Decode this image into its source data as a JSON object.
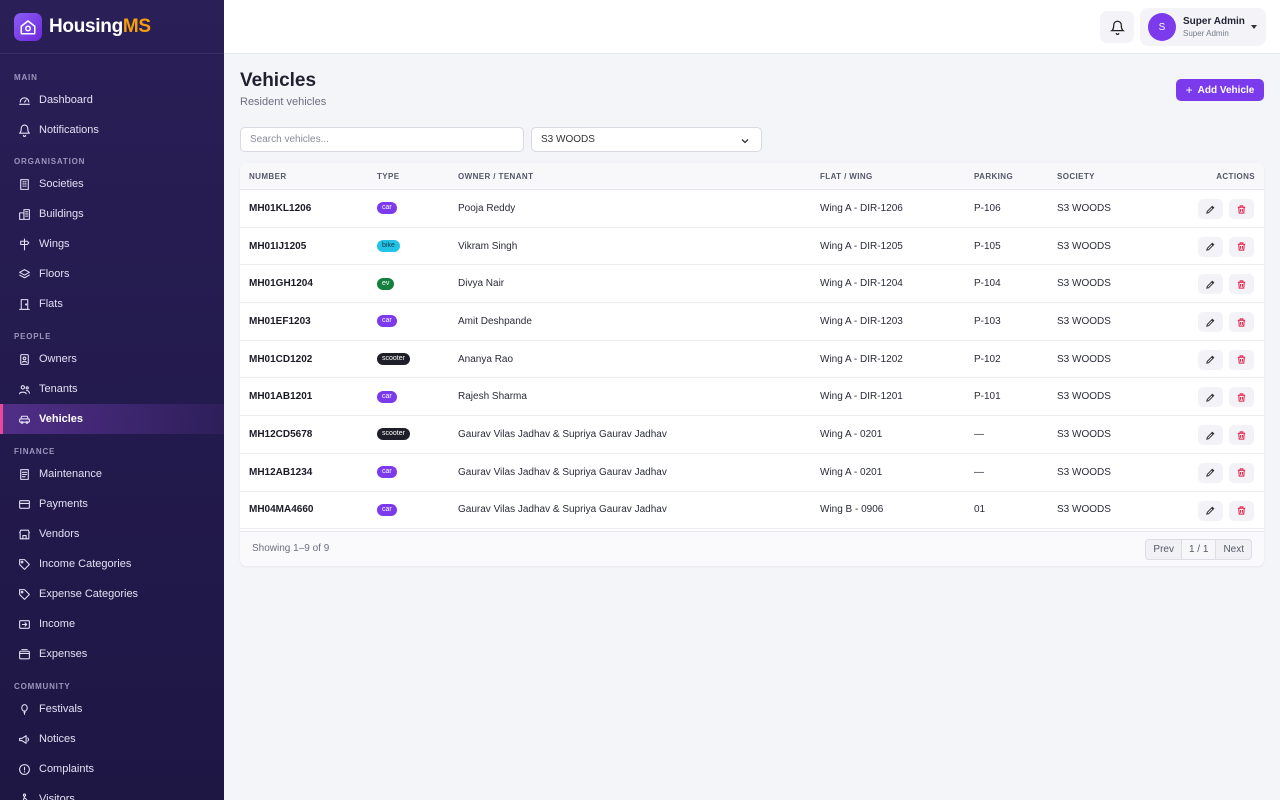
{
  "brand": {
    "name_main": "Housing",
    "name_accent": "MS"
  },
  "sidebar": {
    "sections": [
      {
        "label": "MAIN",
        "items": [
          {
            "label": "Dashboard",
            "icon": "dashboard-gauge-icon"
          },
          {
            "label": "Notifications",
            "icon": "bell-icon"
          }
        ]
      },
      {
        "label": "ORGANISATION",
        "items": [
          {
            "label": "Societies",
            "icon": "building-icon"
          },
          {
            "label": "Buildings",
            "icon": "buildings-icon"
          },
          {
            "label": "Wings",
            "icon": "signpost-icon"
          },
          {
            "label": "Floors",
            "icon": "layers-icon"
          },
          {
            "label": "Flats",
            "icon": "door-icon"
          }
        ]
      },
      {
        "label": "PEOPLE",
        "items": [
          {
            "label": "Owners",
            "icon": "id-badge-icon"
          },
          {
            "label": "Tenants",
            "icon": "users-icon"
          },
          {
            "label": "Vehicles",
            "icon": "car-icon",
            "active": true
          }
        ]
      },
      {
        "label": "FINANCE",
        "items": [
          {
            "label": "Maintenance",
            "icon": "receipt-icon"
          },
          {
            "label": "Payments",
            "icon": "credit-card-icon"
          },
          {
            "label": "Vendors",
            "icon": "store-icon"
          },
          {
            "label": "Income Categories",
            "icon": "tag-icon"
          },
          {
            "label": "Expense Categories",
            "icon": "tag-icon"
          },
          {
            "label": "Income",
            "icon": "transfer-icon"
          },
          {
            "label": "Expenses",
            "icon": "wallet-icon"
          }
        ]
      },
      {
        "label": "COMMUNITY",
        "items": [
          {
            "label": "Festivals",
            "icon": "balloon-icon"
          },
          {
            "label": "Notices",
            "icon": "megaphone-icon"
          },
          {
            "label": "Complaints",
            "icon": "alert-circle-icon"
          },
          {
            "label": "Visitors",
            "icon": "person-walking-icon"
          }
        ]
      }
    ]
  },
  "topbar": {
    "user_initial": "S",
    "user_name": "Super Admin",
    "user_role": "Super Admin"
  },
  "page": {
    "title": "Vehicles",
    "subtitle": "Resident vehicles",
    "add_button": "Add Vehicle"
  },
  "filters": {
    "search_placeholder": "Search vehicles...",
    "society_selected": "S3 WOODS"
  },
  "table": {
    "columns": {
      "number": "NUMBER",
      "type": "TYPE",
      "owner": "OWNER / TENANT",
      "flat": "FLAT / WING",
      "parking": "PARKING",
      "society": "SOCIETY",
      "actions": "ACTIONS"
    },
    "rows": [
      {
        "number": "MH01KL1206",
        "type": "car",
        "owner": "Pooja Reddy",
        "flat": "Wing A - DIR-1206",
        "parking": "P-106",
        "society": "S3 WOODS"
      },
      {
        "number": "MH01IJ1205",
        "type": "bike",
        "owner": "Vikram Singh",
        "flat": "Wing A - DIR-1205",
        "parking": "P-105",
        "society": "S3 WOODS"
      },
      {
        "number": "MH01GH1204",
        "type": "ev",
        "owner": "Divya Nair",
        "flat": "Wing A - DIR-1204",
        "parking": "P-104",
        "society": "S3 WOODS"
      },
      {
        "number": "MH01EF1203",
        "type": "car",
        "owner": "Amit Deshpande",
        "flat": "Wing A - DIR-1203",
        "parking": "P-103",
        "society": "S3 WOODS"
      },
      {
        "number": "MH01CD1202",
        "type": "scooter",
        "owner": "Ananya Rao",
        "flat": "Wing A - DIR-1202",
        "parking": "P-102",
        "society": "S3 WOODS"
      },
      {
        "number": "MH01AB1201",
        "type": "car",
        "owner": "Rajesh Sharma",
        "flat": "Wing A - DIR-1201",
        "parking": "P-101",
        "society": "S3 WOODS"
      },
      {
        "number": "MH12CD5678",
        "type": "scooter",
        "owner": "Gaurav Vilas Jadhav & Supriya Gaurav Jadhav",
        "flat": "Wing A - 0201",
        "parking": "—",
        "society": "S3 WOODS"
      },
      {
        "number": "MH12AB1234",
        "type": "car",
        "owner": "Gaurav Vilas Jadhav & Supriya Gaurav Jadhav",
        "flat": "Wing A - 0201",
        "parking": "—",
        "society": "S3 WOODS"
      },
      {
        "number": "MH04MA4660",
        "type": "car",
        "owner": "Gaurav Vilas Jadhav & Supriya Gaurav Jadhav",
        "flat": "Wing B - 0906",
        "parking": "01",
        "society": "S3 WOODS"
      }
    ],
    "footer": {
      "showing": "Showing 1–9 of 9",
      "prev": "Prev",
      "page": "1 / 1",
      "next": "Next"
    }
  },
  "colors": {
    "accent": "#7c3aed",
    "sidebar_bg": "#231a4d",
    "brand_accent": "#f59e0b",
    "active_marker": "#ec4899",
    "delete": "#e11d48"
  }
}
